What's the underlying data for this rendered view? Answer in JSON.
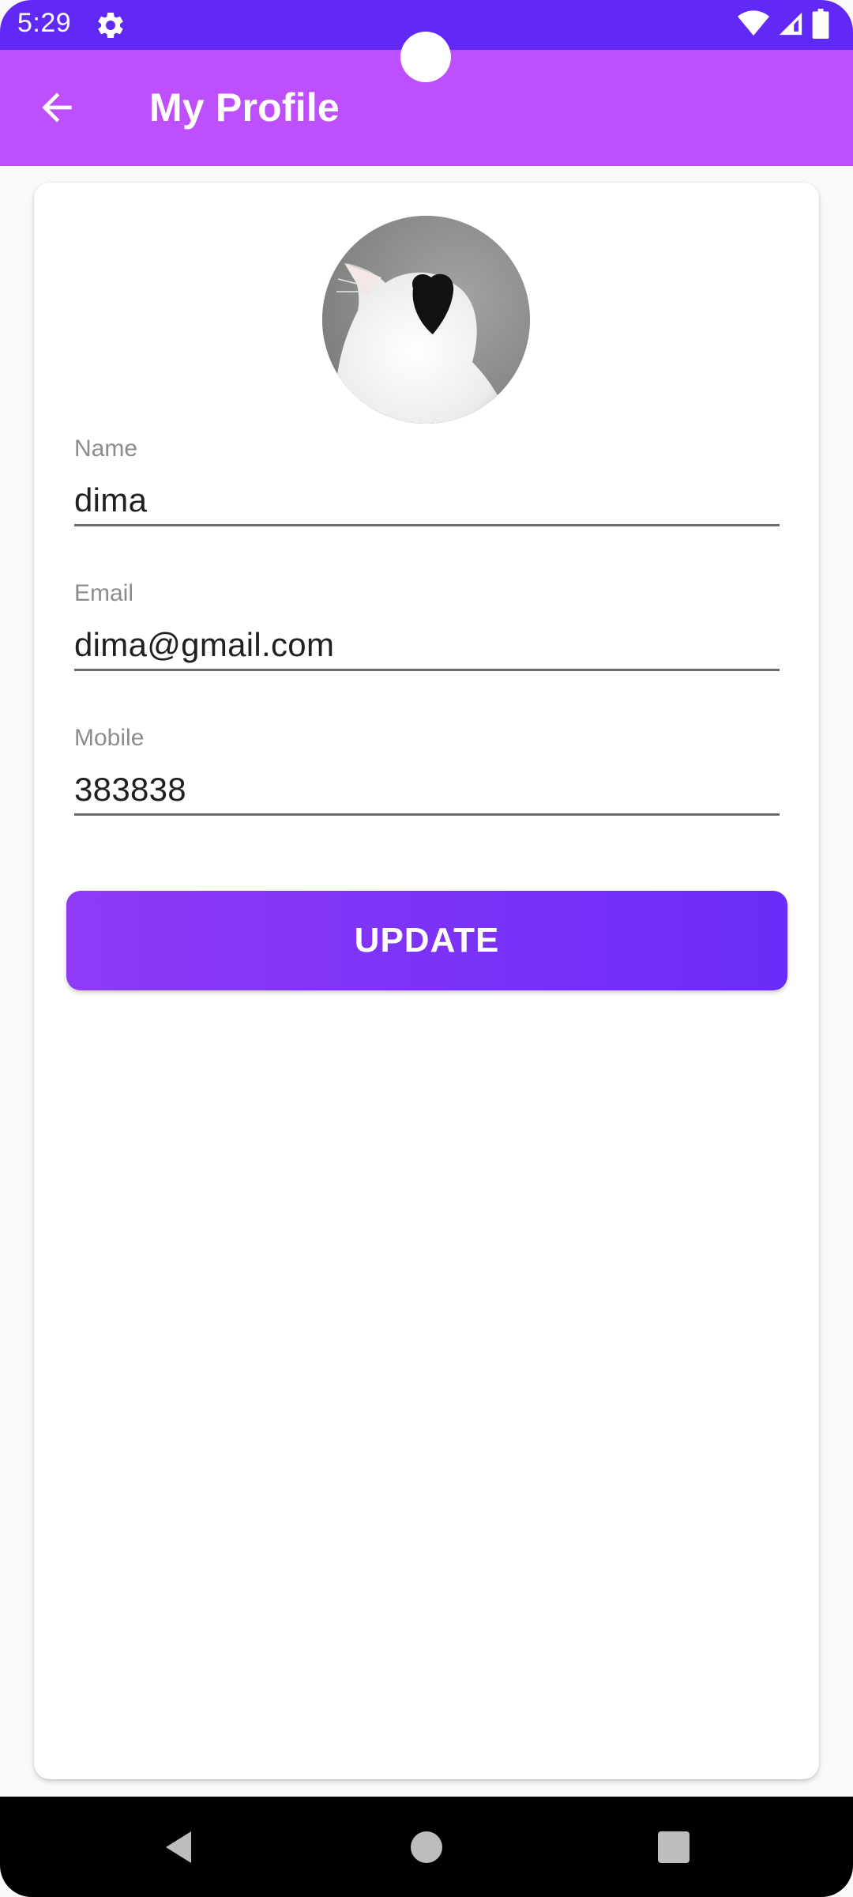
{
  "status_bar": {
    "time": "5:29",
    "icons": [
      "gear-icon",
      "wifi-icon",
      "signal-icon",
      "battery-icon"
    ],
    "color": "#6029f6"
  },
  "app_bar": {
    "title": "My Profile",
    "back_icon": "arrow-left-icon",
    "color": "#be4ffc"
  },
  "profile": {
    "avatar_description": "profile-photo"
  },
  "form": {
    "fields": [
      {
        "label": "Name",
        "value": "dima"
      },
      {
        "label": "Email",
        "value": "dima@gmail.com"
      },
      {
        "label": "Mobile",
        "value": "383838"
      }
    ],
    "update_label": "UPDATE",
    "button_color": "#7c33f7"
  },
  "nav_bar": {
    "icons": [
      "back-triangle-icon",
      "home-circle-icon",
      "recents-square-icon"
    ]
  }
}
